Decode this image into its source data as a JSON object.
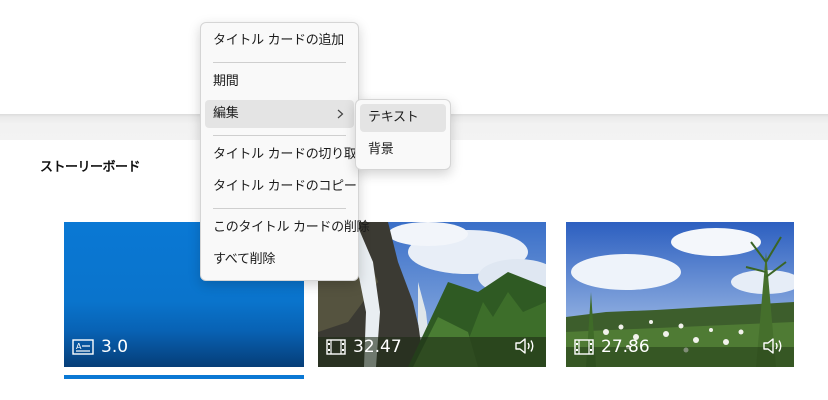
{
  "storyboard": {
    "label": "ストーリーボード"
  },
  "clips": [
    {
      "type": "title-card",
      "icon": "title-card-icon",
      "duration": "3.0",
      "selected": true,
      "color": "#0a78d4"
    },
    {
      "type": "video",
      "icon": "film-icon",
      "duration": "32.47",
      "has_audio": true,
      "audio_icon": "speaker-icon"
    },
    {
      "type": "video",
      "icon": "film-icon",
      "duration": "27.86",
      "has_audio": true,
      "audio_icon": "speaker-icon"
    }
  ],
  "context_menu": {
    "items": [
      {
        "label": "タイトル カードの追加"
      },
      {
        "label": "期間"
      },
      {
        "label": "編集",
        "has_submenu": true,
        "active": true
      },
      {
        "label": "タイトル カードの切り取り"
      },
      {
        "label": "タイトル カードのコピー"
      },
      {
        "label": "このタイトル カードの削除"
      },
      {
        "label": "すべて削除"
      }
    ],
    "submenu": {
      "items": [
        {
          "label": "テキスト",
          "active": true
        },
        {
          "label": "背景"
        }
      ]
    }
  }
}
